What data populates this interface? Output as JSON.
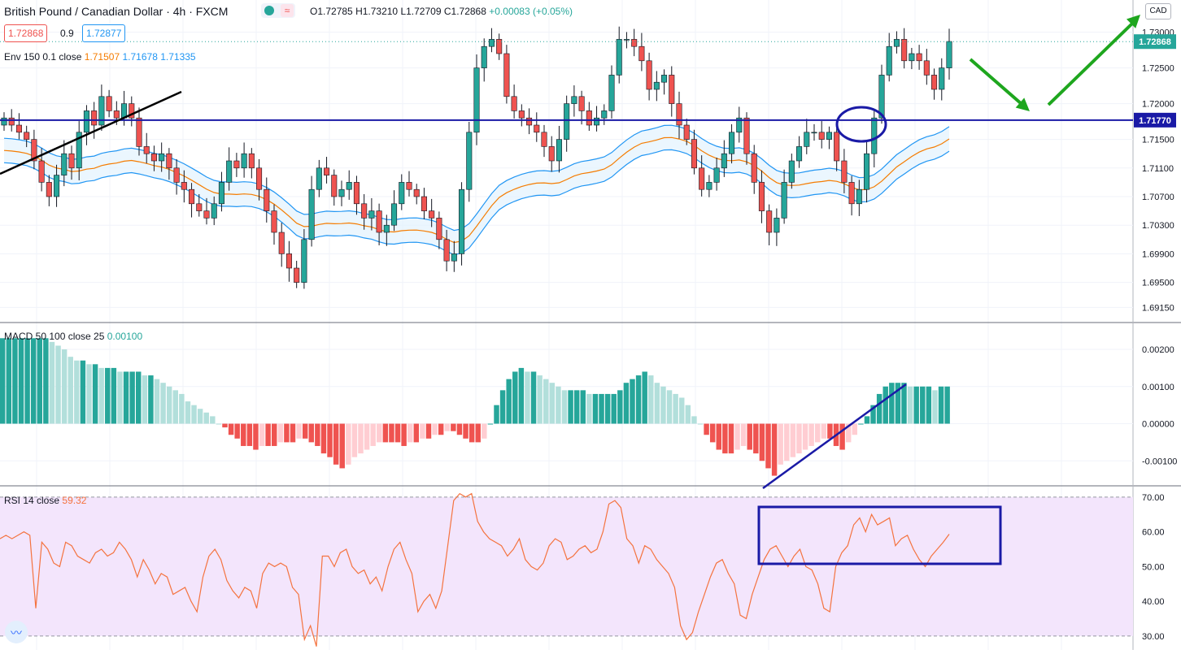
{
  "header": {
    "title": "British Pound / Canadian Dollar · 4h · FXCM",
    "open": "O1.72785",
    "high": "H1.73210",
    "low": "L1.72709",
    "close": "C1.72868",
    "change": "+0.00083 (+0.05%)",
    "sell_price": "1.72868",
    "spread": "0.9",
    "buy_price": "1.72877",
    "currency": "CAD"
  },
  "indicators": {
    "env_label": "Env 150 0.1 close",
    "env_v1": "1.71507",
    "env_v2": "1.71678",
    "env_v3": "1.71335",
    "macd_label": "MACD 50 100 close 25",
    "macd_value": "0.00100",
    "rsi_label": "RSI 14 close",
    "rsi_value": "59.32"
  },
  "colors": {
    "up": "#26a69a",
    "down": "#ef5350",
    "up_light": "#b2dfdb",
    "down_light": "#ffcdd2",
    "env_band": "#2196f3",
    "env_mid": "#f57c00",
    "rsi_line": "#f4733f",
    "rsi_band": "#f3e5fc",
    "annotation": "#1a1aa6",
    "arrow": "#1ea61e"
  },
  "chart_data": [
    {
      "type": "candlestick",
      "title": "British Pound / Canadian Dollar · 4h · FXCM",
      "y_ticks": [
        "1.73000",
        "1.72500",
        "1.72000",
        "1.71500",
        "1.71100",
        "1.70700",
        "1.70300",
        "1.69900",
        "1.69500",
        "1.69150"
      ],
      "ylim": [
        1.6895,
        1.7345
      ],
      "last_price_label": "1.72868",
      "horizontal_level_label": "1.71770",
      "horizontal_level": 1.7177,
      "price_path": [
        1.718,
        1.717,
        1.716,
        1.715,
        1.712,
        1.709,
        1.707,
        1.71,
        1.713,
        1.711,
        1.716,
        1.719,
        1.717,
        1.721,
        1.719,
        1.718,
        1.72,
        1.718,
        1.714,
        1.713,
        1.712,
        1.713,
        1.711,
        1.709,
        1.708,
        1.706,
        1.705,
        1.704,
        1.706,
        1.709,
        1.712,
        1.711,
        1.713,
        1.711,
        1.708,
        1.705,
        1.702,
        1.699,
        1.697,
        1.695,
        1.701,
        1.708,
        1.711,
        1.71,
        1.707,
        1.708,
        1.709,
        1.706,
        1.704,
        1.705,
        1.702,
        1.703,
        1.706,
        1.709,
        1.708,
        1.707,
        1.705,
        1.704,
        1.701,
        1.698,
        1.699,
        1.708,
        1.716,
        1.725,
        1.728,
        1.729,
        1.727,
        1.721,
        1.719,
        1.718,
        1.717,
        1.716,
        1.714,
        1.712,
        1.715,
        1.72,
        1.721,
        1.719,
        1.717,
        1.718,
        1.719,
        1.724,
        1.729,
        1.729,
        1.728,
        1.726,
        1.722,
        1.723,
        1.724,
        1.72,
        1.717,
        1.715,
        1.711,
        1.708,
        1.709,
        1.711,
        1.713,
        1.716,
        1.718,
        1.713,
        1.709,
        1.705,
        1.702,
        1.704,
        1.709,
        1.712,
        1.714,
        1.716,
        1.716,
        1.715,
        1.716,
        1.712,
        1.709,
        1.706,
        1.708,
        1.713,
        1.718,
        1.724,
        1.728,
        1.729,
        1.726,
        1.727,
        1.726,
        1.724,
        1.722,
        1.725,
        1.7287
      ],
      "envelope_upper_last": 1.71678,
      "envelope_mid_last": 1.71507,
      "envelope_lower_last": 1.71335
    },
    {
      "type": "histogram",
      "title": "MACD 50 100 close 25",
      "y_ticks": [
        "0.00200",
        "0.00100",
        "0.00000",
        "-0.00100"
      ],
      "ylim": [
        -0.00165,
        0.0027
      ],
      "values": [
        0.0023,
        0.0023,
        0.0023,
        0.0023,
        0.0023,
        0.0023,
        0.0023,
        0.0023,
        0.0022,
        0.0021,
        0.002,
        0.0018,
        0.0017,
        0.0017,
        0.0016,
        0.0016,
        0.0015,
        0.0015,
        0.0015,
        0.0014,
        0.0014,
        0.0014,
        0.0014,
        0.0013,
        0.0013,
        0.0012,
        0.0011,
        0.001,
        0.0009,
        0.0008,
        0.0006,
        0.0005,
        0.0004,
        0.0003,
        0.0002,
        0.0,
        -0.0001,
        -0.0003,
        -0.0004,
        -0.0006,
        -0.0006,
        -0.0007,
        -0.0006,
        -0.0006,
        -0.0006,
        -0.0005,
        -0.0005,
        -0.0005,
        -0.0004,
        -0.0004,
        -0.0005,
        -0.0006,
        -0.0008,
        -0.0009,
        -0.0011,
        -0.0012,
        -0.0011,
        -0.0009,
        -0.0008,
        -0.0007,
        -0.0006,
        -0.0005,
        -0.0005,
        -0.0005,
        -0.0005,
        -0.0006,
        -0.0005,
        -0.0005,
        -0.0004,
        -0.0004,
        -0.0003,
        -0.0003,
        -0.0002,
        -0.0002,
        -0.0003,
        -0.0004,
        -0.0005,
        -0.0005,
        -0.0004,
        0.0,
        0.0005,
        0.0009,
        0.0012,
        0.0014,
        0.0015,
        0.0014,
        0.0014,
        0.0013,
        0.0012,
        0.0011,
        0.001,
        0.0009,
        0.0009,
        0.0009,
        0.0009,
        0.0008,
        0.0008,
        0.0008,
        0.0008,
        0.0008,
        0.0009,
        0.0011,
        0.0012,
        0.0013,
        0.0014,
        0.0013,
        0.0011,
        0.001,
        0.0009,
        0.0008,
        0.0007,
        0.0005,
        0.0002,
        0.0,
        -0.0003,
        -0.0005,
        -0.0007,
        -0.0008,
        -0.0008,
        -0.0007,
        -0.0006,
        -0.0007,
        -0.0008,
        -0.001,
        -0.0012,
        -0.0014,
        -0.0011,
        -0.001,
        -0.0009,
        -0.0008,
        -0.0007,
        -0.0006,
        -0.0005,
        -0.0004,
        -0.0004,
        -0.0006,
        -0.0007,
        -0.0005,
        -0.0003,
        0.0,
        0.0002,
        0.0005,
        0.0008,
        0.001,
        0.0011,
        0.0011,
        0.0011,
        0.001,
        0.001,
        0.001,
        0.001,
        0.0009,
        0.001,
        0.001
      ]
    },
    {
      "type": "line",
      "title": "RSI 14 close",
      "y_ticks": [
        "70.00",
        "60.00",
        "50.00",
        "40.00",
        "30.00"
      ],
      "ylim": [
        26,
        73
      ],
      "band": [
        30,
        70
      ],
      "values": [
        58,
        59,
        58,
        59,
        60,
        59,
        38,
        57,
        55,
        51,
        50,
        57,
        56,
        53,
        52,
        51,
        54,
        55,
        53,
        54,
        57,
        55,
        52,
        47,
        52,
        49,
        45,
        48,
        47,
        42,
        43,
        44,
        40,
        37,
        47,
        53,
        55,
        52,
        46,
        43,
        41,
        44,
        43,
        38,
        48,
        51,
        50,
        51,
        50,
        44,
        42,
        29,
        33,
        27,
        53,
        53,
        50,
        54,
        55,
        50,
        48,
        49,
        45,
        47,
        43,
        50,
        55,
        57,
        52,
        48,
        37,
        40,
        42,
        38,
        43,
        56,
        69,
        71,
        70,
        71,
        63,
        60,
        58,
        57,
        56,
        53,
        55,
        58,
        52,
        50,
        49,
        51,
        56,
        58,
        57,
        52,
        53,
        55,
        56,
        54,
        55,
        60,
        68,
        69,
        67,
        58,
        56,
        51,
        56,
        55,
        52,
        50,
        48,
        44,
        33,
        29,
        31,
        37,
        42,
        47,
        51,
        52,
        48,
        45,
        36,
        35,
        42,
        47,
        52,
        55,
        56,
        53,
        50,
        53,
        55,
        50,
        49,
        45,
        38,
        37,
        50,
        54,
        56,
        62,
        64,
        60,
        65,
        62,
        63,
        64,
        56,
        58,
        59,
        55,
        52,
        50,
        53,
        55,
        57,
        59.32
      ]
    }
  ],
  "annotations": {
    "trendline_color": "#000000",
    "level_box": "1.71770"
  }
}
